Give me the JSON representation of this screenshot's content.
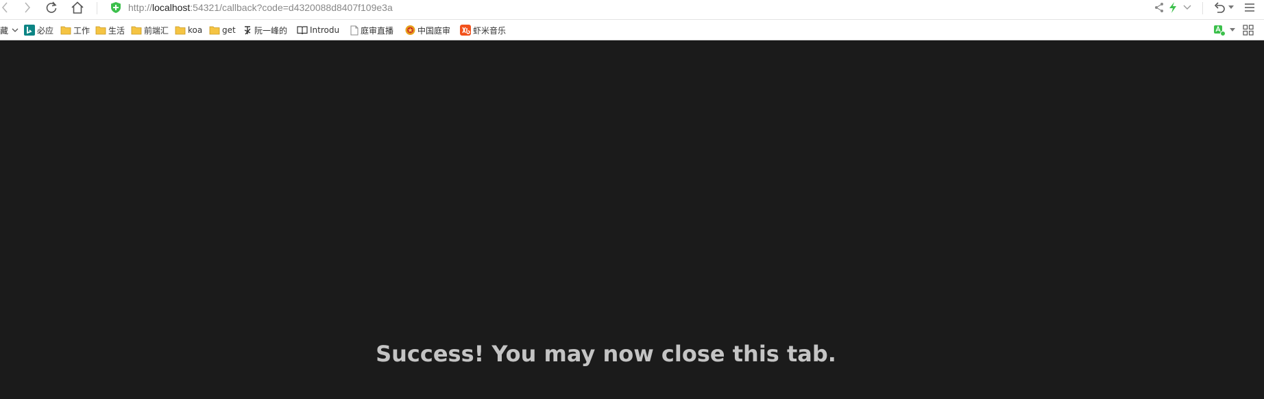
{
  "url": {
    "prefix": "http://",
    "host": "localhost",
    "rest": ":54321/callback?code=d4320088d8407f109e3a"
  },
  "bookmarks": {
    "favorites_label": "藏",
    "items": [
      {
        "label": "必应",
        "icon": "bing-icon"
      },
      {
        "label": "工作",
        "icon": "folder-icon"
      },
      {
        "label": "生活",
        "icon": "folder-icon"
      },
      {
        "label": "前端汇",
        "icon": "folder-icon"
      },
      {
        "label": "koa",
        "icon": "folder-icon"
      },
      {
        "label": "get",
        "icon": "folder-icon"
      },
      {
        "label": "阮一峰的",
        "icon": "ruanyifeng-icon"
      },
      {
        "label": "Introdu",
        "icon": "book-icon"
      },
      {
        "label": "庭审直播",
        "icon": "page-icon"
      },
      {
        "label": "中国庭审",
        "icon": "court-emblem-icon"
      },
      {
        "label": "虾米音乐",
        "icon": "xiami-icon"
      }
    ]
  },
  "page": {
    "message": "Success! You may now close this tab."
  },
  "colors": {
    "background": "#1b1b1b",
    "message": "#c4c4c4",
    "secure_green": "#3cc04c",
    "folder_yellow": "#f5c443"
  }
}
